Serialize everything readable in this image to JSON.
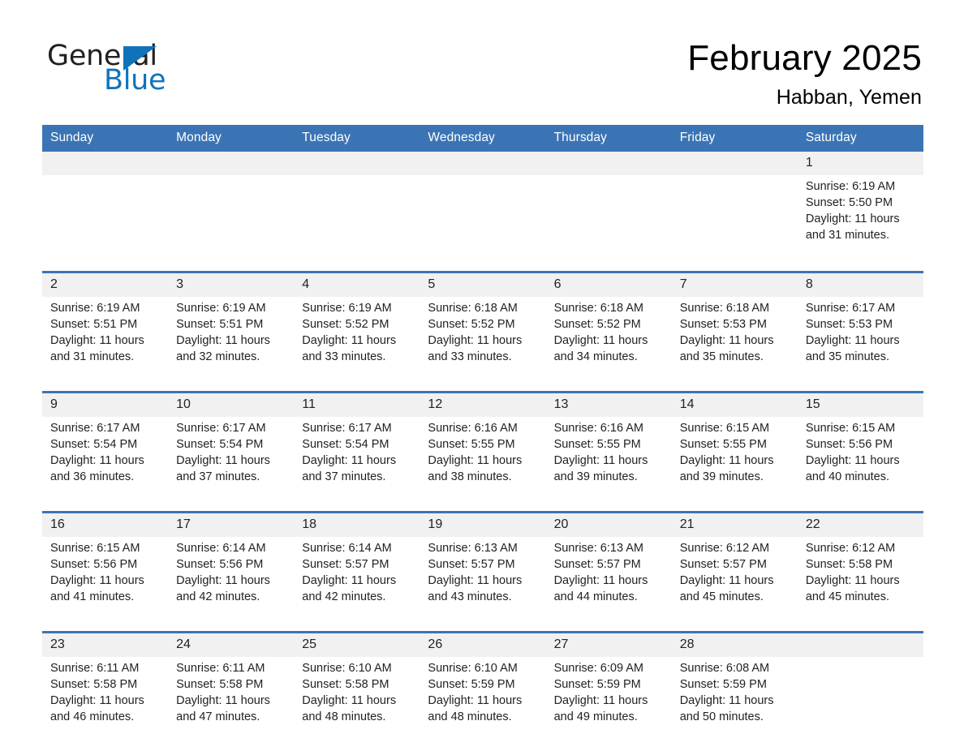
{
  "brand": {
    "word_one": "General",
    "word_two": "Blue",
    "triangle_icon": "triangle-icon"
  },
  "header": {
    "title": "February 2025",
    "location": "Habban, Yemen"
  },
  "colors": {
    "header_blue": "#3b74b4",
    "brand_blue": "#1073ba",
    "day_band_gray": "#f1f1f1",
    "text": "#222222"
  },
  "weekday_headers": [
    "Sunday",
    "Monday",
    "Tuesday",
    "Wednesday",
    "Thursday",
    "Friday",
    "Saturday"
  ],
  "weeks": [
    [
      {
        "day": "",
        "sunrise": "",
        "sunset": "",
        "daylight_line1": "",
        "daylight_line2": ""
      },
      {
        "day": "",
        "sunrise": "",
        "sunset": "",
        "daylight_line1": "",
        "daylight_line2": ""
      },
      {
        "day": "",
        "sunrise": "",
        "sunset": "",
        "daylight_line1": "",
        "daylight_line2": ""
      },
      {
        "day": "",
        "sunrise": "",
        "sunset": "",
        "daylight_line1": "",
        "daylight_line2": ""
      },
      {
        "day": "",
        "sunrise": "",
        "sunset": "",
        "daylight_line1": "",
        "daylight_line2": ""
      },
      {
        "day": "",
        "sunrise": "",
        "sunset": "",
        "daylight_line1": "",
        "daylight_line2": ""
      },
      {
        "day": "1",
        "sunrise": "Sunrise: 6:19 AM",
        "sunset": "Sunset: 5:50 PM",
        "daylight_line1": "Daylight: 11 hours",
        "daylight_line2": "and 31 minutes."
      }
    ],
    [
      {
        "day": "2",
        "sunrise": "Sunrise: 6:19 AM",
        "sunset": "Sunset: 5:51 PM",
        "daylight_line1": "Daylight: 11 hours",
        "daylight_line2": "and 31 minutes."
      },
      {
        "day": "3",
        "sunrise": "Sunrise: 6:19 AM",
        "sunset": "Sunset: 5:51 PM",
        "daylight_line1": "Daylight: 11 hours",
        "daylight_line2": "and 32 minutes."
      },
      {
        "day": "4",
        "sunrise": "Sunrise: 6:19 AM",
        "sunset": "Sunset: 5:52 PM",
        "daylight_line1": "Daylight: 11 hours",
        "daylight_line2": "and 33 minutes."
      },
      {
        "day": "5",
        "sunrise": "Sunrise: 6:18 AM",
        "sunset": "Sunset: 5:52 PM",
        "daylight_line1": "Daylight: 11 hours",
        "daylight_line2": "and 33 minutes."
      },
      {
        "day": "6",
        "sunrise": "Sunrise: 6:18 AM",
        "sunset": "Sunset: 5:52 PM",
        "daylight_line1": "Daylight: 11 hours",
        "daylight_line2": "and 34 minutes."
      },
      {
        "day": "7",
        "sunrise": "Sunrise: 6:18 AM",
        "sunset": "Sunset: 5:53 PM",
        "daylight_line1": "Daylight: 11 hours",
        "daylight_line2": "and 35 minutes."
      },
      {
        "day": "8",
        "sunrise": "Sunrise: 6:17 AM",
        "sunset": "Sunset: 5:53 PM",
        "daylight_line1": "Daylight: 11 hours",
        "daylight_line2": "and 35 minutes."
      }
    ],
    [
      {
        "day": "9",
        "sunrise": "Sunrise: 6:17 AM",
        "sunset": "Sunset: 5:54 PM",
        "daylight_line1": "Daylight: 11 hours",
        "daylight_line2": "and 36 minutes."
      },
      {
        "day": "10",
        "sunrise": "Sunrise: 6:17 AM",
        "sunset": "Sunset: 5:54 PM",
        "daylight_line1": "Daylight: 11 hours",
        "daylight_line2": "and 37 minutes."
      },
      {
        "day": "11",
        "sunrise": "Sunrise: 6:17 AM",
        "sunset": "Sunset: 5:54 PM",
        "daylight_line1": "Daylight: 11 hours",
        "daylight_line2": "and 37 minutes."
      },
      {
        "day": "12",
        "sunrise": "Sunrise: 6:16 AM",
        "sunset": "Sunset: 5:55 PM",
        "daylight_line1": "Daylight: 11 hours",
        "daylight_line2": "and 38 minutes."
      },
      {
        "day": "13",
        "sunrise": "Sunrise: 6:16 AM",
        "sunset": "Sunset: 5:55 PM",
        "daylight_line1": "Daylight: 11 hours",
        "daylight_line2": "and 39 minutes."
      },
      {
        "day": "14",
        "sunrise": "Sunrise: 6:15 AM",
        "sunset": "Sunset: 5:55 PM",
        "daylight_line1": "Daylight: 11 hours",
        "daylight_line2": "and 39 minutes."
      },
      {
        "day": "15",
        "sunrise": "Sunrise: 6:15 AM",
        "sunset": "Sunset: 5:56 PM",
        "daylight_line1": "Daylight: 11 hours",
        "daylight_line2": "and 40 minutes."
      }
    ],
    [
      {
        "day": "16",
        "sunrise": "Sunrise: 6:15 AM",
        "sunset": "Sunset: 5:56 PM",
        "daylight_line1": "Daylight: 11 hours",
        "daylight_line2": "and 41 minutes."
      },
      {
        "day": "17",
        "sunrise": "Sunrise: 6:14 AM",
        "sunset": "Sunset: 5:56 PM",
        "daylight_line1": "Daylight: 11 hours",
        "daylight_line2": "and 42 minutes."
      },
      {
        "day": "18",
        "sunrise": "Sunrise: 6:14 AM",
        "sunset": "Sunset: 5:57 PM",
        "daylight_line1": "Daylight: 11 hours",
        "daylight_line2": "and 42 minutes."
      },
      {
        "day": "19",
        "sunrise": "Sunrise: 6:13 AM",
        "sunset": "Sunset: 5:57 PM",
        "daylight_line1": "Daylight: 11 hours",
        "daylight_line2": "and 43 minutes."
      },
      {
        "day": "20",
        "sunrise": "Sunrise: 6:13 AM",
        "sunset": "Sunset: 5:57 PM",
        "daylight_line1": "Daylight: 11 hours",
        "daylight_line2": "and 44 minutes."
      },
      {
        "day": "21",
        "sunrise": "Sunrise: 6:12 AM",
        "sunset": "Sunset: 5:57 PM",
        "daylight_line1": "Daylight: 11 hours",
        "daylight_line2": "and 45 minutes."
      },
      {
        "day": "22",
        "sunrise": "Sunrise: 6:12 AM",
        "sunset": "Sunset: 5:58 PM",
        "daylight_line1": "Daylight: 11 hours",
        "daylight_line2": "and 45 minutes."
      }
    ],
    [
      {
        "day": "23",
        "sunrise": "Sunrise: 6:11 AM",
        "sunset": "Sunset: 5:58 PM",
        "daylight_line1": "Daylight: 11 hours",
        "daylight_line2": "and 46 minutes."
      },
      {
        "day": "24",
        "sunrise": "Sunrise: 6:11 AM",
        "sunset": "Sunset: 5:58 PM",
        "daylight_line1": "Daylight: 11 hours",
        "daylight_line2": "and 47 minutes."
      },
      {
        "day": "25",
        "sunrise": "Sunrise: 6:10 AM",
        "sunset": "Sunset: 5:58 PM",
        "daylight_line1": "Daylight: 11 hours",
        "daylight_line2": "and 48 minutes."
      },
      {
        "day": "26",
        "sunrise": "Sunrise: 6:10 AM",
        "sunset": "Sunset: 5:59 PM",
        "daylight_line1": "Daylight: 11 hours",
        "daylight_line2": "and 48 minutes."
      },
      {
        "day": "27",
        "sunrise": "Sunrise: 6:09 AM",
        "sunset": "Sunset: 5:59 PM",
        "daylight_line1": "Daylight: 11 hours",
        "daylight_line2": "and 49 minutes."
      },
      {
        "day": "28",
        "sunrise": "Sunrise: 6:08 AM",
        "sunset": "Sunset: 5:59 PM",
        "daylight_line1": "Daylight: 11 hours",
        "daylight_line2": "and 50 minutes."
      },
      {
        "day": "",
        "sunrise": "",
        "sunset": "",
        "daylight_line1": "",
        "daylight_line2": ""
      }
    ]
  ]
}
